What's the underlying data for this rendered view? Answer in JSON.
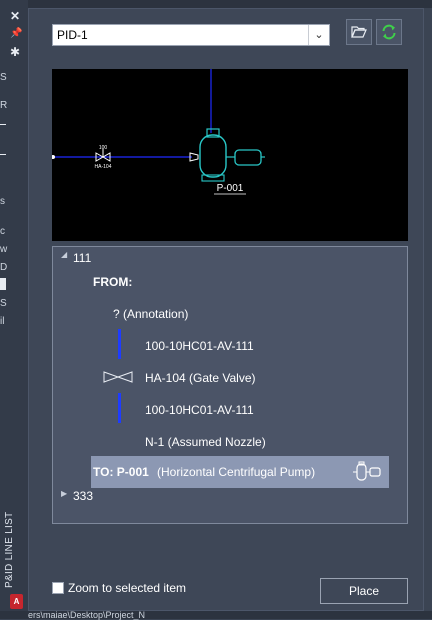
{
  "window": {
    "close_glyph": "✕",
    "pin_glyph": "📌",
    "settings_glyph": "✱",
    "palette_title": "P&ID LINE LIST",
    "app_badge": "A",
    "footer_path": "ers\\maiae\\Desktop\\Project_N"
  },
  "left_strip": {
    "letters": [
      "S",
      "R",
      "s",
      "c",
      "w",
      "D",
      "S",
      "il"
    ]
  },
  "toolbar": {
    "drawing_value": "PID-1",
    "open_icon": "folder-open-icon",
    "refresh_icon": "refresh-icon"
  },
  "preview": {
    "valve_tag_top": "100",
    "valve_tag_bottom": "HA-104",
    "pump_tag": "P-001",
    "colors": {
      "line": "#1f2bff",
      "equipment": "#29c7c7",
      "tag": "#ffffff"
    }
  },
  "tree": {
    "line_111_label": "111",
    "from_label": "FROM:",
    "items": [
      {
        "label": "? (Annotation)",
        "icon": "none"
      },
      {
        "label": "100-10HC01-AV-111",
        "icon": "line-segment-icon"
      },
      {
        "label": "HA-104 (Gate Valve)",
        "icon": "gate-valve-icon"
      },
      {
        "label": "100-10HC01-AV-111",
        "icon": "line-segment-icon"
      },
      {
        "label": "N-1 (Assumed Nozzle)",
        "icon": "none"
      }
    ],
    "to_label": "TO: P-001",
    "to_desc": "(Horizontal Centrifugal Pump)",
    "line_333_label": "333"
  },
  "footer": {
    "zoom_label": "Zoom to selected item",
    "zoom_checked": false,
    "place_label": "Place"
  }
}
